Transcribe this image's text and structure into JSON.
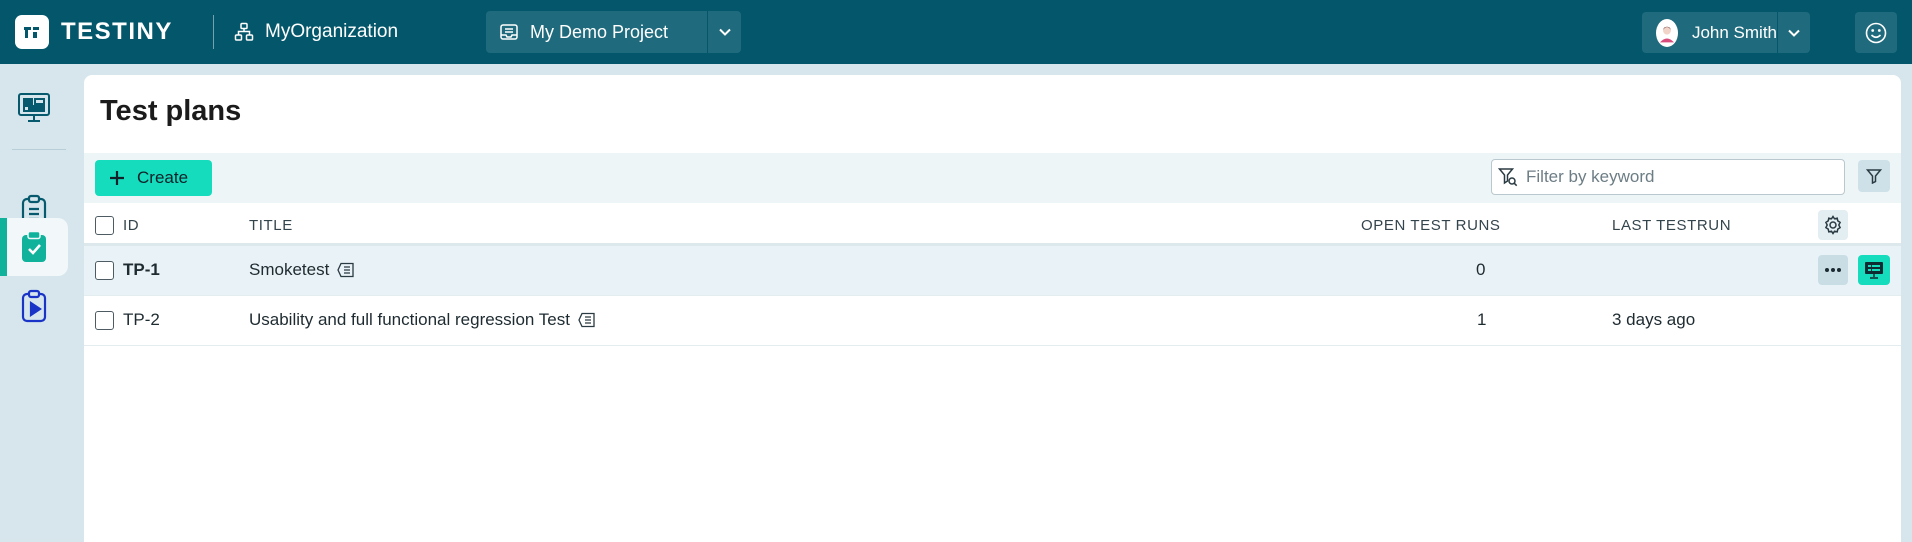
{
  "app": {
    "name": "TESTINY"
  },
  "header": {
    "organization": "MyOrganization",
    "project": "My Demo Project",
    "user_name": "John Smith"
  },
  "page": {
    "title": "Test plans"
  },
  "toolbar": {
    "create_label": "Create",
    "filter_placeholder": "Filter by keyword"
  },
  "table": {
    "columns": {
      "id": "ID",
      "title": "TITLE",
      "open_runs": "OPEN TEST RUNS",
      "last_run": "LAST TESTRUN"
    },
    "rows": [
      {
        "id": "TP-1",
        "title": "Smoketest",
        "open_runs": "0",
        "last_run": "",
        "highlighted": true
      },
      {
        "id": "TP-2",
        "title": "Usability and full functional regression Test",
        "open_runs": "1",
        "last_run": "3 days ago",
        "highlighted": false
      }
    ]
  },
  "sidebar": {
    "items": [
      {
        "icon": "dashboard-monitor-icon",
        "active": false
      },
      {
        "icon": "clipboard-list-icon",
        "active": false
      },
      {
        "icon": "clipboard-check-icon",
        "active": true
      },
      {
        "icon": "clipboard-play-icon",
        "active": false
      }
    ]
  },
  "colors": {
    "header_bg": "#04576b",
    "accent": "#15dcbc",
    "active_indicator": "#10b29c"
  }
}
